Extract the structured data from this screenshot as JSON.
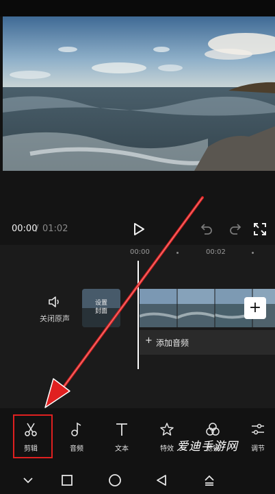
{
  "player": {
    "current_time": "00:00",
    "separator": "/",
    "total_time": "01:02"
  },
  "timeline": {
    "ticks": [
      "00:00",
      "00:02"
    ],
    "mute_label": "关闭原声",
    "cover_label_line1": "设置",
    "cover_label_line2": "封面",
    "add_audio_plus": "+",
    "add_audio_label": "添加音频",
    "add_clip_symbol": "+"
  },
  "toolbar": {
    "items": [
      {
        "label": "剪辑",
        "icon": "scissors-icon"
      },
      {
        "label": "音频",
        "icon": "music-note-icon"
      },
      {
        "label": "文本",
        "icon": "text-icon"
      },
      {
        "label": "特效",
        "icon": "effects-star-icon"
      },
      {
        "label": "滤镜",
        "icon": "filter-icon"
      },
      {
        "label": "调节",
        "icon": "adjust-sliders-icon"
      }
    ]
  },
  "watermark": "爱迪手游网",
  "annotation": {
    "highlight_color": "#e02020",
    "arrow_color": "#e02020"
  }
}
